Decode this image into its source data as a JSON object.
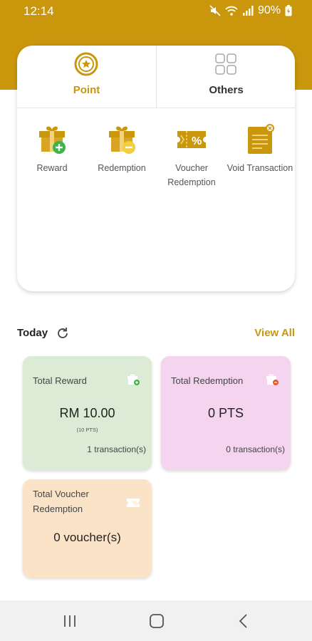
{
  "status_bar": {
    "time": "12:14",
    "battery": "90%"
  },
  "tabs": [
    {
      "label": "Point",
      "icon": "star-coin-icon",
      "active": true
    },
    {
      "label": "Others",
      "icon": "grid-icon",
      "active": false
    }
  ],
  "actions": [
    {
      "label": "Reward",
      "icon": "gift-plus-icon"
    },
    {
      "label": "Redemption",
      "icon": "gift-minus-icon"
    },
    {
      "label": "Voucher Redemption",
      "icon": "voucher-percent-icon"
    },
    {
      "label": "Void Transaction",
      "icon": "void-document-icon"
    }
  ],
  "today": {
    "label": "Today",
    "view_all": "View All"
  },
  "cards": {
    "reward": {
      "title": "Total Reward",
      "value": "RM 10.00",
      "sub": "(10 PTS)",
      "count": "1 transaction(s)"
    },
    "redemption": {
      "title": "Total Redemption",
      "value": "0 PTS",
      "count": "0 transaction(s)"
    },
    "voucher": {
      "title_line1": "Total Voucher",
      "title_line2": "Redemption",
      "value": "0 voucher(s)"
    }
  },
  "colors": {
    "accent": "#c9960c",
    "reward_bg": "#dcebd6",
    "redemption_bg": "#f5d4ef",
    "voucher_bg": "#fbe3c8"
  }
}
